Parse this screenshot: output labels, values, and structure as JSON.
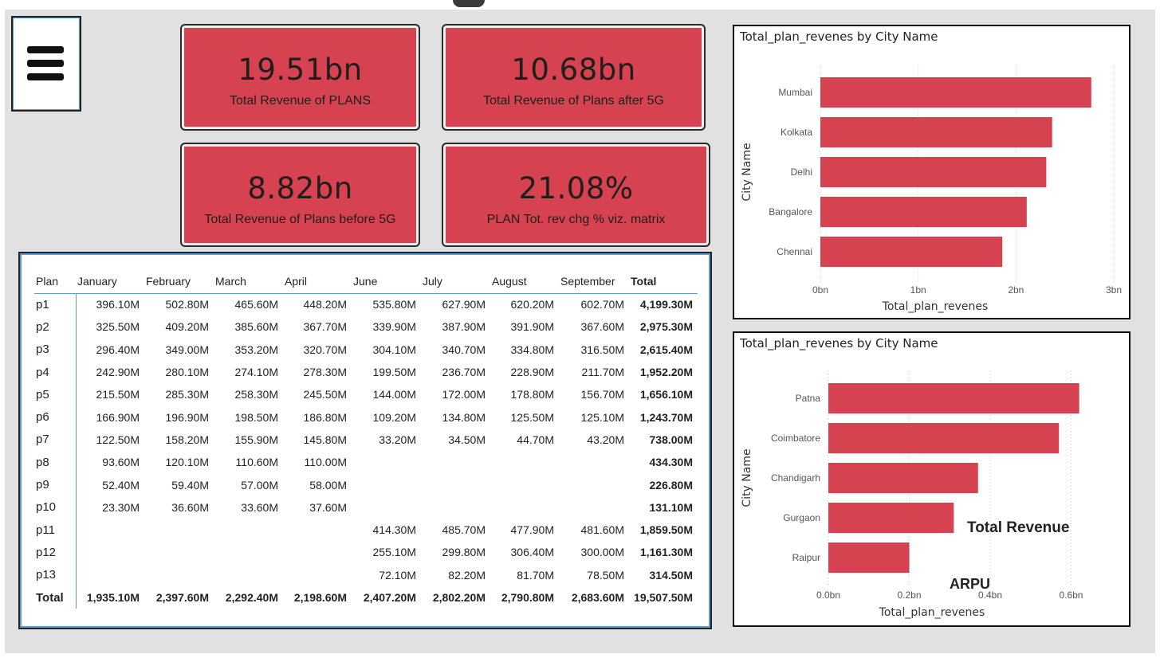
{
  "colors": {
    "accent": "#d6424f",
    "canvas": "#e1e1e1",
    "rule": "#5b9bd5"
  },
  "menu": {
    "icon": "hamburger-menu-icon"
  },
  "kpis": [
    {
      "value": "19.51bn",
      "label": "Total Revenue of PLANS"
    },
    {
      "value": "10.68bn",
      "label": "Total Revenue of Plans after 5G"
    },
    {
      "value": "8.82bn",
      "label": "Total Revenue of Plans before 5G"
    },
    {
      "value": "21.08%",
      "label": "PLAN Tot. rev chg % viz. matrix"
    }
  ],
  "matrix": {
    "columns": [
      "Plan",
      "January",
      "February",
      "March",
      "April",
      "June",
      "July",
      "August",
      "September",
      "Total"
    ],
    "rows": [
      [
        "p1",
        "396.10M",
        "502.80M",
        "465.60M",
        "448.20M",
        "535.80M",
        "627.90M",
        "620.20M",
        "602.70M",
        "4,199.30M"
      ],
      [
        "p2",
        "325.50M",
        "409.20M",
        "385.60M",
        "367.70M",
        "339.90M",
        "387.90M",
        "391.90M",
        "367.60M",
        "2,975.30M"
      ],
      [
        "p3",
        "296.40M",
        "349.00M",
        "353.20M",
        "320.70M",
        "304.10M",
        "340.70M",
        "334.80M",
        "316.50M",
        "2,615.40M"
      ],
      [
        "p4",
        "242.90M",
        "280.10M",
        "274.10M",
        "278.30M",
        "199.50M",
        "236.70M",
        "228.90M",
        "211.70M",
        "1,952.20M"
      ],
      [
        "p5",
        "215.50M",
        "285.30M",
        "258.30M",
        "245.50M",
        "144.00M",
        "172.00M",
        "178.80M",
        "156.70M",
        "1,656.10M"
      ],
      [
        "p6",
        "166.90M",
        "196.90M",
        "198.50M",
        "186.80M",
        "109.20M",
        "134.80M",
        "125.50M",
        "125.10M",
        "1,243.70M"
      ],
      [
        "p7",
        "122.50M",
        "158.20M",
        "155.90M",
        "145.80M",
        "33.20M",
        "34.50M",
        "44.70M",
        "43.20M",
        "738.00M"
      ],
      [
        "p8",
        "93.60M",
        "120.10M",
        "110.60M",
        "110.00M",
        "",
        "",
        "",
        "",
        "434.30M"
      ],
      [
        "p9",
        "52.40M",
        "59.40M",
        "57.00M",
        "58.00M",
        "",
        "",
        "",
        "",
        "226.80M"
      ],
      [
        "p10",
        "23.30M",
        "36.60M",
        "33.60M",
        "37.60M",
        "",
        "",
        "",
        "",
        "131.10M"
      ],
      [
        "p11",
        "",
        "",
        "",
        "",
        "414.30M",
        "485.70M",
        "477.90M",
        "481.60M",
        "1,859.50M"
      ],
      [
        "p12",
        "",
        "",
        "",
        "",
        "255.10M",
        "299.80M",
        "306.40M",
        "300.00M",
        "1,161.30M"
      ],
      [
        "p13",
        "",
        "",
        "",
        "",
        "72.10M",
        "82.20M",
        "81.70M",
        "78.50M",
        "314.50M"
      ]
    ],
    "total_row": [
      "Total",
      "1,935.10M",
      "2,397.60M",
      "2,292.40M",
      "2,198.60M",
      "2,407.20M",
      "2,802.20M",
      "2,790.80M",
      "2,683.60M",
      "19,507.50M"
    ]
  },
  "overlay": {
    "total_revenue": "Total Revenue",
    "arpu": "ARPU"
  },
  "chart_data": [
    {
      "type": "bar",
      "orientation": "horizontal",
      "title": "Total_plan_revenes by City Name",
      "xlabel": "Total_plan_revenes",
      "ylabel": "City Name",
      "categories": [
        "Mumbai",
        "Kolkata",
        "Delhi",
        "Bangalore",
        "Chennai"
      ],
      "values": [
        2.77,
        2.37,
        2.31,
        2.11,
        1.86
      ],
      "xlim": [
        0,
        3
      ],
      "ticks": [
        0,
        1,
        2,
        3
      ],
      "tick_labels": [
        "0bn",
        "1bn",
        "2bn",
        "3bn"
      ],
      "grid": true
    },
    {
      "type": "bar",
      "orientation": "horizontal",
      "title": "Total_plan_revenes by City Name",
      "xlabel": "Total_plan_revenes",
      "ylabel": "City Name",
      "categories": [
        "Patna",
        "Coimbatore",
        "Chandigarh",
        "Gurgaon",
        "Raipur"
      ],
      "values": [
        0.62,
        0.57,
        0.37,
        0.31,
        0.2
      ],
      "xlim": [
        0,
        0.67
      ],
      "ticks": [
        0,
        0.2,
        0.4,
        0.6
      ],
      "tick_labels": [
        "0.0bn",
        "0.2bn",
        "0.4bn",
        "0.6bn"
      ],
      "grid": true
    }
  ]
}
